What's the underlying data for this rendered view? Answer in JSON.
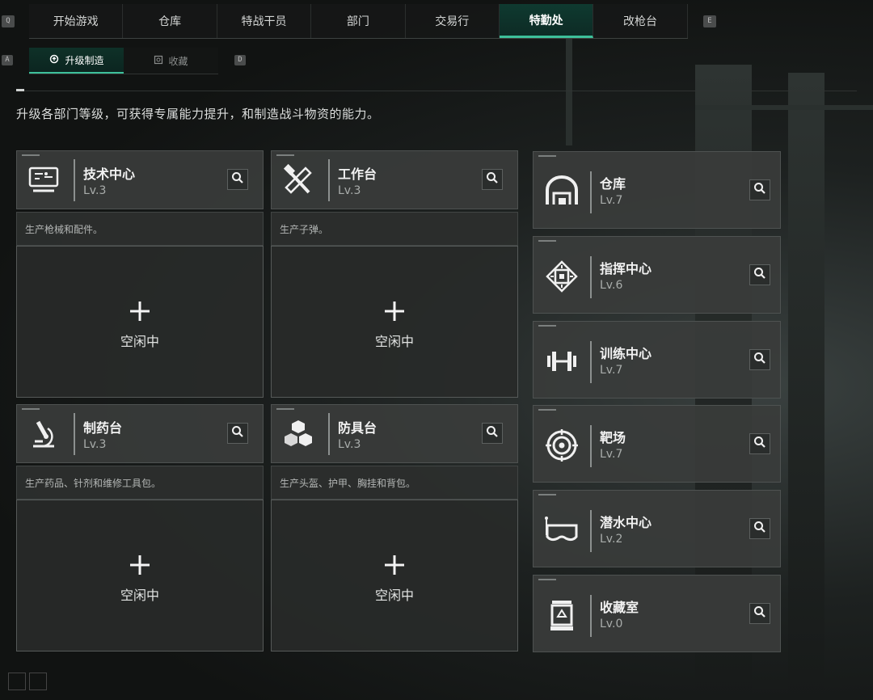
{
  "keys": {
    "prev_tab": "Q",
    "next_tab": "E",
    "prev_sub": "A",
    "next_sub": "D"
  },
  "tabs": [
    {
      "label": "开始游戏",
      "name": "tab-start-game"
    },
    {
      "label": "仓库",
      "name": "tab-warehouse"
    },
    {
      "label": "特战干员",
      "name": "tab-operators"
    },
    {
      "label": "部门",
      "name": "tab-department"
    },
    {
      "label": "交易行",
      "name": "tab-trading"
    },
    {
      "label": "特勤处",
      "name": "tab-special-service",
      "active": true
    },
    {
      "label": "改枪台",
      "name": "tab-gunsmith"
    }
  ],
  "subtabs": [
    {
      "label": "升级制造",
      "active": true
    },
    {
      "label": "收藏"
    }
  ],
  "description": "升级各部门等级，可获得专属能力提升，和制造战斗物资的能力。",
  "workshops": [
    {
      "name": "技术中心",
      "level": "Lv.3",
      "desc": "生产枪械和配件。",
      "status": "空闲中",
      "icon": "computer-icon"
    },
    {
      "name": "工作台",
      "level": "Lv.3",
      "desc": "生产子弹。",
      "status": "空闲中",
      "icon": "hammer-wrench-icon"
    },
    {
      "name": "制药台",
      "level": "Lv.3",
      "desc": "生产药品、针剂和维修工具包。",
      "status": "空闲中",
      "icon": "microscope-icon"
    },
    {
      "name": "防具台",
      "level": "Lv.3",
      "desc": "生产头盔、护甲、胸挂和背包。",
      "status": "空闲中",
      "icon": "cubes-icon"
    }
  ],
  "facilities": [
    {
      "name": "仓库",
      "level": "Lv.7",
      "icon": "warehouse-icon"
    },
    {
      "name": "指挥中心",
      "level": "Lv.6",
      "icon": "chip-icon"
    },
    {
      "name": "训练中心",
      "level": "Lv.7",
      "icon": "dumbbell-icon"
    },
    {
      "name": "靶场",
      "level": "Lv.7",
      "icon": "target-icon"
    },
    {
      "name": "潜水中心",
      "level": "Lv.2",
      "icon": "dive-mask-icon"
    },
    {
      "name": "收藏室",
      "level": "Lv.0",
      "icon": "display-case-icon"
    }
  ],
  "colors": {
    "accent": "#3dc09a",
    "card": "#3a3c3b",
    "text": "#f2f2f2"
  }
}
